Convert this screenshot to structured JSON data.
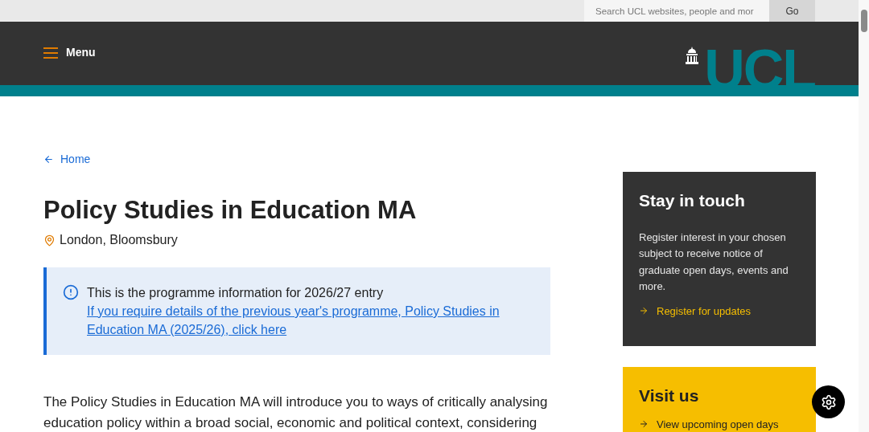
{
  "search": {
    "placeholder": "Search UCL websites, people and mor",
    "button": "Go"
  },
  "header": {
    "menu": "Menu",
    "logo": "UCL"
  },
  "breadcrumb": {
    "label": "Home"
  },
  "title": "Policy Studies in Education MA",
  "location": "London, Bloomsbury",
  "notice": {
    "text": "This is the programme information for 2026/27 entry",
    "link": "If you require details of the previous year's programme, Policy Studies in Education MA (2025/26), click here"
  },
  "intro": "The Policy Studies in Education MA will introduce you to ways of critically analysing education policy within a broad social, economic and political context, considering",
  "cards": [
    {
      "kind": "dark",
      "title": "Stay in touch",
      "text": "Register interest in your chosen subject to receive notice of graduate open days, events and more.",
      "link": "Register for updates"
    },
    {
      "kind": "yellow",
      "title": "Visit us",
      "link": "View upcoming open days"
    }
  ]
}
